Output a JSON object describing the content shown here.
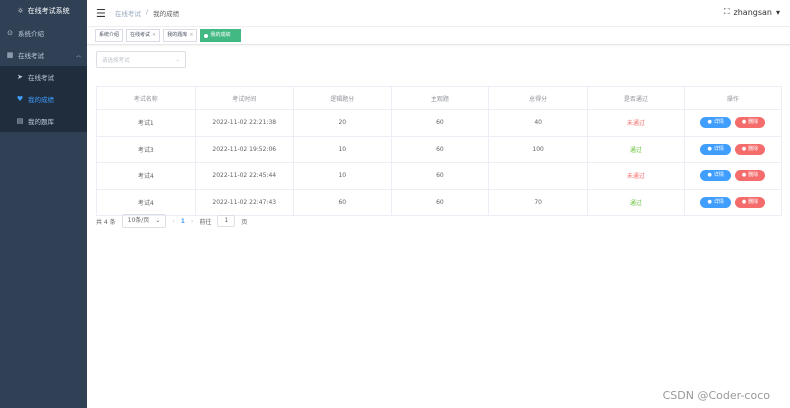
{
  "sidebar": {
    "title": "在线考试系统",
    "items": [
      {
        "label": "系统介绍",
        "icon": "info-icon"
      },
      {
        "label": "在线考试",
        "icon": "grid-icon"
      },
      {
        "label": "在线考试",
        "icon": "send-icon"
      },
      {
        "label": "我的成绩",
        "icon": "trophy-icon"
      },
      {
        "label": "我的题库",
        "icon": "book-icon"
      }
    ]
  },
  "header": {
    "breadcrumb": [
      "在线考试",
      "/",
      "我的成绩"
    ],
    "username": "zhangsan"
  },
  "tags": [
    {
      "label": "系统介绍"
    },
    {
      "label": "在线考试"
    },
    {
      "label": "我的题库"
    },
    {
      "label": "我的成绩"
    }
  ],
  "filter": {
    "placeholder": "请选择考试"
  },
  "table": {
    "headers": [
      "考试名称",
      "考试时间",
      "逻辑题分",
      "主观题",
      "总得分",
      "是否通过",
      "操作"
    ],
    "rows": [
      {
        "name": "考试1",
        "time": "2022-11-02 22:21:38",
        "logic": "20",
        "subj": "60",
        "total": "40",
        "status": "未通过"
      },
      {
        "name": "考试3",
        "time": "2022-11-02 19:52:06",
        "logic": "10",
        "subj": "60",
        "total": "100",
        "status": "通过"
      },
      {
        "name": "考试4",
        "time": "2022-11-02 22:45:44",
        "logic": "10",
        "subj": "60",
        "total": "",
        "status": "未通过"
      },
      {
        "name": "考试4",
        "time": "2022-11-02 22:47:43",
        "logic": "60",
        "subj": "60",
        "total": "70",
        "status": "通过"
      }
    ],
    "detail_label": "详情",
    "delete_label": "删除"
  },
  "pager": {
    "total": "共 4 条",
    "size": "10条/页",
    "current": "1",
    "goto_label": "前往",
    "goto_value": "1",
    "page_suffix": "页"
  },
  "watermark": "CSDN @Coder-coco",
  "colors": {
    "sidebar": "#304156",
    "accent": "#409eff",
    "pass": "#67c23a",
    "fail": "#f56c6c",
    "active_tag": "#42b983"
  }
}
